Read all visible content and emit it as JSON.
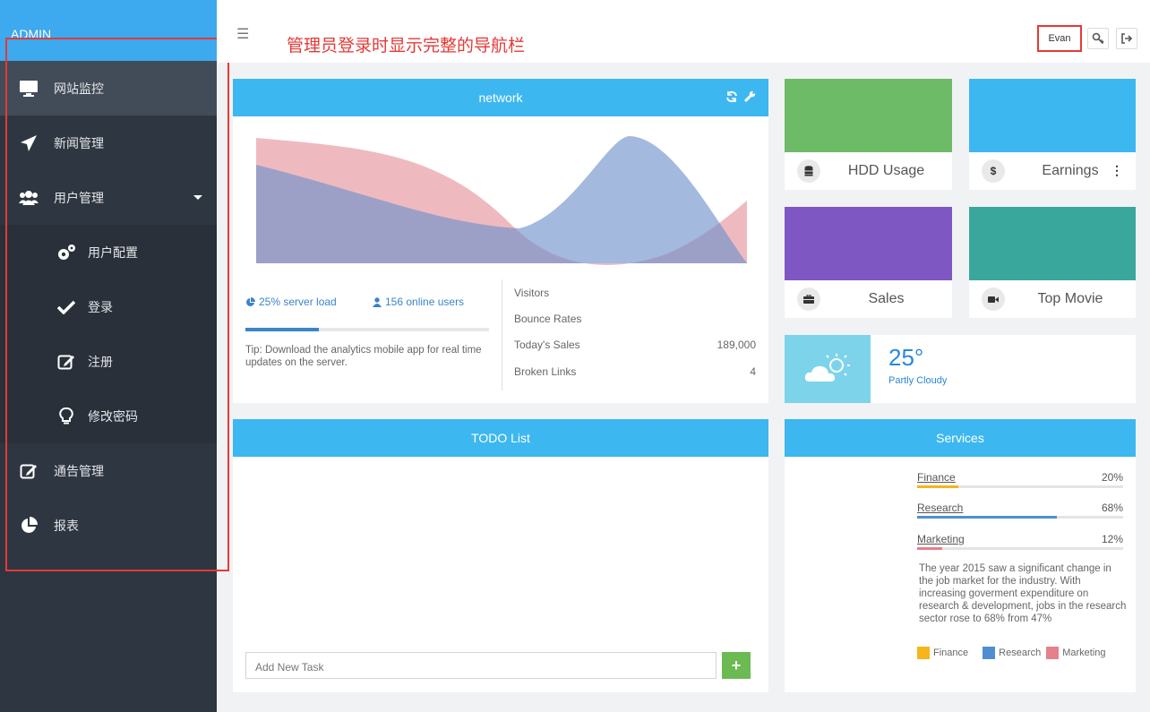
{
  "brand": "ADMIN",
  "annotation": "管理员登录时显示完整的导航栏",
  "topbar": {
    "user": "Evan"
  },
  "sidebar": {
    "items": [
      {
        "label": "网站监控"
      },
      {
        "label": "新闻管理"
      },
      {
        "label": "用户管理"
      },
      {
        "label": "用户配置"
      },
      {
        "label": "登录"
      },
      {
        "label": "注册"
      },
      {
        "label": "修改密码"
      },
      {
        "label": "通告管理"
      },
      {
        "label": "报表"
      }
    ]
  },
  "network": {
    "title": "network",
    "server_load": "25% server load",
    "online_users": "156 online users",
    "progress": 0.3,
    "tip": "Tip: Download the analytics mobile app for real time updates on the server.",
    "stats": [
      {
        "label": "Visitors",
        "value": ""
      },
      {
        "label": "Bounce Rates",
        "value": ""
      },
      {
        "label": "Today's Sales",
        "value": "189,000"
      },
      {
        "label": "Broken Links",
        "value": "4"
      }
    ]
  },
  "tiles": [
    {
      "label": "HDD Usage",
      "color": "#6dba67",
      "icon": "database-icon"
    },
    {
      "label": "Earnings",
      "color": "#3db7f0",
      "icon": "dollar-icon"
    },
    {
      "label": "Sales",
      "color": "#7e57c2",
      "icon": "briefcase-icon"
    },
    {
      "label": "Top Movie",
      "color": "#3aa79d",
      "icon": "video-camera-icon"
    }
  ],
  "weather": {
    "temp": "25°",
    "condition": "Partly Cloudy"
  },
  "todo": {
    "title": "TODO List",
    "placeholder": "Add New Task"
  },
  "services": {
    "title": "Services",
    "items": [
      {
        "name": "Finance",
        "pct": "20%",
        "value": 20,
        "color": "#f5b51b"
      },
      {
        "name": "Research",
        "pct": "68%",
        "value": 68,
        "color": "#4f8fd1"
      },
      {
        "name": "Marketing",
        "pct": "12%",
        "value": 12,
        "color": "#e5808c"
      }
    ],
    "text": "The year 2015 saw a significant change in the job market for the industry. With increasing goverment expenditure on research & development, jobs in the research sector rose to 68% from 47%",
    "legend": [
      "Finance",
      "Research",
      "Marketing"
    ]
  }
}
